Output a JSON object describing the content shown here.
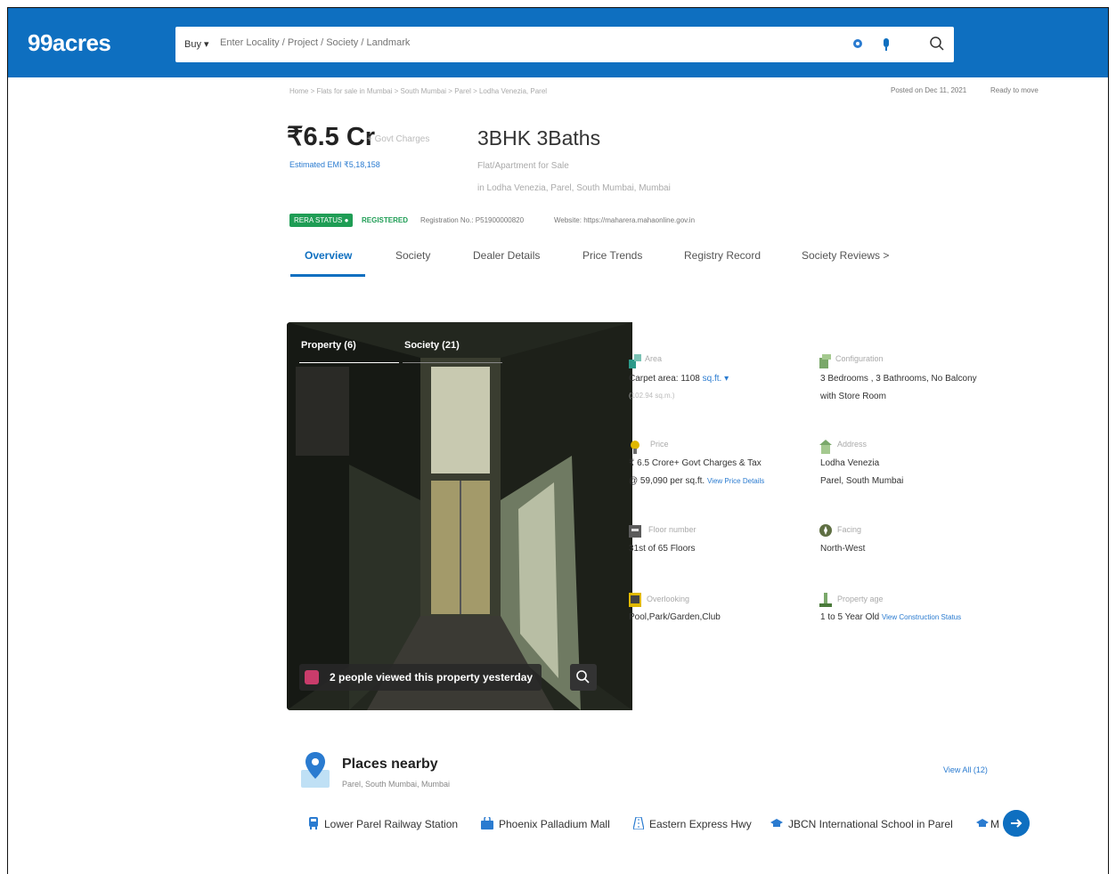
{
  "header": {
    "logo": "99acres",
    "buy_label": "Buy ▾",
    "search_placeholder": "Enter Locality / Project / Society / Landmark"
  },
  "breadcrumb": "Home  >  Flats for sale in Mumbai  >  South Mumbai  >  Parel  >  Lodha Venezia, Parel",
  "posted": "Posted on Dec 11, 2021",
  "status": "Ready to move",
  "listing": {
    "price": "₹6.5 Cr",
    "price_note": "+ Govt Charges",
    "emi": "Estimated EMI ₹5,18,158",
    "title": "3BHK 3Baths",
    "subtitle1": "Flat/Apartment for Sale",
    "subtitle2": "in Lodha Venezia, Parel, South Mumbai, Mumbai"
  },
  "rera": {
    "badge": "RERA STATUS",
    "registered": "REGISTERED",
    "reg_no": "Registration No.: P51900000820",
    "website": "Website: https://maharera.mahaonline.gov.in"
  },
  "tabs": [
    "Overview",
    "Society",
    "Dealer Details",
    "Price Trends",
    "Registry Record",
    "Society Reviews  >"
  ],
  "gallery": {
    "tab_property": "Property (6)",
    "tab_society": "Society (21)",
    "views_text": "2 people viewed this property yesterday"
  },
  "details": {
    "area_label": "Area",
    "area_value": "Carpet area: 1108",
    "area_unit": "sq.ft.",
    "area_note": "(102.94 sq.m.)",
    "config_label": "Configuration",
    "config_value1": "3 Bedrooms , 3 Bathrooms, No Balcony",
    "config_value2": "with Store Room",
    "price_label": "Price",
    "price_value1": "₹ 6.5 Crore+ Govt Charges & Tax",
    "price_value2": "@ 59,090 per sq.ft.",
    "price_link": "View Price Details",
    "address_label": "Address",
    "address_value1": "Lodha Venezia",
    "address_value2": "Parel, South Mumbai",
    "floor_label": "Floor number",
    "floor_value": "31st  of 65 Floors",
    "facing_label": "Facing",
    "facing_value": "North-West",
    "overlook_label": "Overlooking",
    "overlook_value": "Pool,Park/Garden,Club",
    "age_label": "Property age",
    "age_value": "1 to 5 Year Old",
    "age_link": "View Construction Status"
  },
  "places": {
    "title": "Places nearby",
    "subtitle": "Parel, South Mumbai, Mumbai",
    "view_all": "View All (12)",
    "chips": [
      "Lower Parel Railway Station",
      "Phoenix Palladium Mall",
      "Eastern Express Hwy",
      "JBCN International School in Parel",
      "M"
    ]
  }
}
